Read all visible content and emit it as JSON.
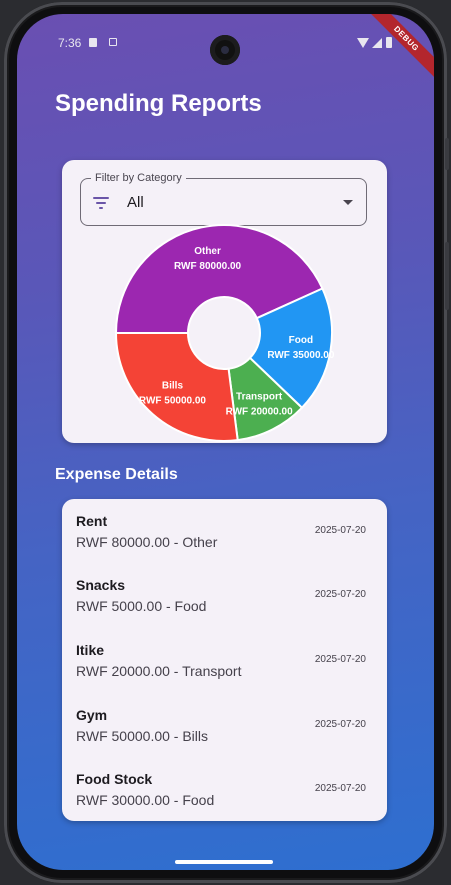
{
  "status_bar": {
    "time": "7:36"
  },
  "debug_banner": "DEBUG",
  "page_title": "Spending Reports",
  "filter": {
    "label": "Filter by Category",
    "value": "All",
    "icon": "filter-list-icon"
  },
  "chart_data": {
    "type": "pie",
    "style": "donut",
    "categories": [
      "Other",
      "Food",
      "Transport",
      "Bills"
    ],
    "values": [
      80000,
      35000,
      20000,
      50000
    ],
    "labels": [
      "RWF 80000.00",
      "RWF 35000.00",
      "RWF 20000.00",
      "RWF 50000.00"
    ],
    "colors": [
      "#9c27b0",
      "#2196f3",
      "#4caf50",
      "#f44336"
    ]
  },
  "section_title": "Expense Details",
  "expenses": [
    {
      "name": "Rent",
      "detail": "RWF 80000.00 - Other",
      "date": "2025-07-20"
    },
    {
      "name": "Snacks",
      "detail": "RWF 5000.00 - Food",
      "date": "2025-07-20"
    },
    {
      "name": "Itike",
      "detail": "RWF 20000.00 - Transport",
      "date": "2025-07-20"
    },
    {
      "name": "Gym",
      "detail": "RWF 50000.00 - Bills",
      "date": "2025-07-20"
    },
    {
      "name": "Food Stock",
      "detail": "RWF 30000.00 - Food",
      "date": "2025-07-20"
    }
  ]
}
